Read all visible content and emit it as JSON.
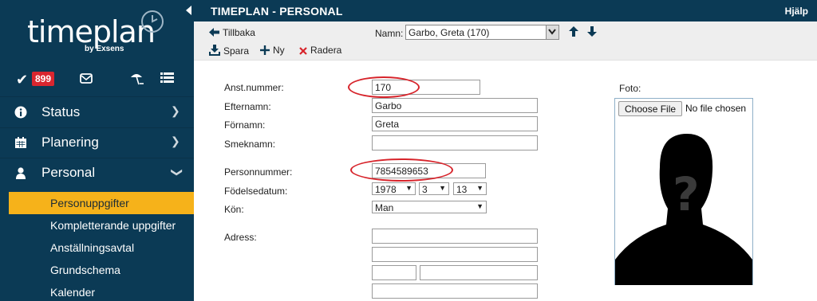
{
  "sidebar": {
    "logo_text": "timeplan",
    "logo_sub": "by Exsens",
    "badge_count": "899",
    "nav": [
      {
        "label": "Status",
        "icon": "info-icon"
      },
      {
        "label": "Planering",
        "icon": "calendar-icon"
      },
      {
        "label": "Personal",
        "icon": "person-icon"
      }
    ],
    "sub_items": [
      {
        "label": "Personuppgifter",
        "active": true
      },
      {
        "label": "Kompletterande uppgifter"
      },
      {
        "label": "Anställningsavtal"
      },
      {
        "label": "Grundschema"
      },
      {
        "label": "Kalender"
      }
    ]
  },
  "header": {
    "title": "TIMEPLAN - PERSONAL",
    "help": "Hjälp"
  },
  "toolbar": {
    "back_label": "Tillbaka",
    "name_label": "Namn:",
    "name_value": "Garbo, Greta (170)",
    "save_label": "Spara",
    "new_label": "Ny",
    "delete_label": "Radera"
  },
  "form": {
    "anst_label": "Anst.nummer:",
    "anst_value": "170",
    "efternamn_label": "Efternamn:",
    "efternamn_value": "Garbo",
    "fornamn_label": "Förnamn:",
    "fornamn_value": "Greta",
    "smeknamn_label": "Smeknamn:",
    "smeknamn_value": "",
    "personnummer_label": "Personnummer:",
    "personnummer_value": "7854589653",
    "fodelsedatum_label": "Födelsedatum:",
    "birth_year": "1978",
    "birth_month": "3",
    "birth_day": "13",
    "kon_label": "Kön:",
    "kon_value": "Man",
    "adress_label": "Adress:"
  },
  "photo": {
    "label": "Foto:",
    "choose_button": "Choose File",
    "file_status": "No file chosen"
  },
  "colors": {
    "sidebar_bg": "#0b3a55",
    "active_item": "#f6b21a",
    "badge": "#d9262f",
    "annotation_red": "#d7242b"
  }
}
